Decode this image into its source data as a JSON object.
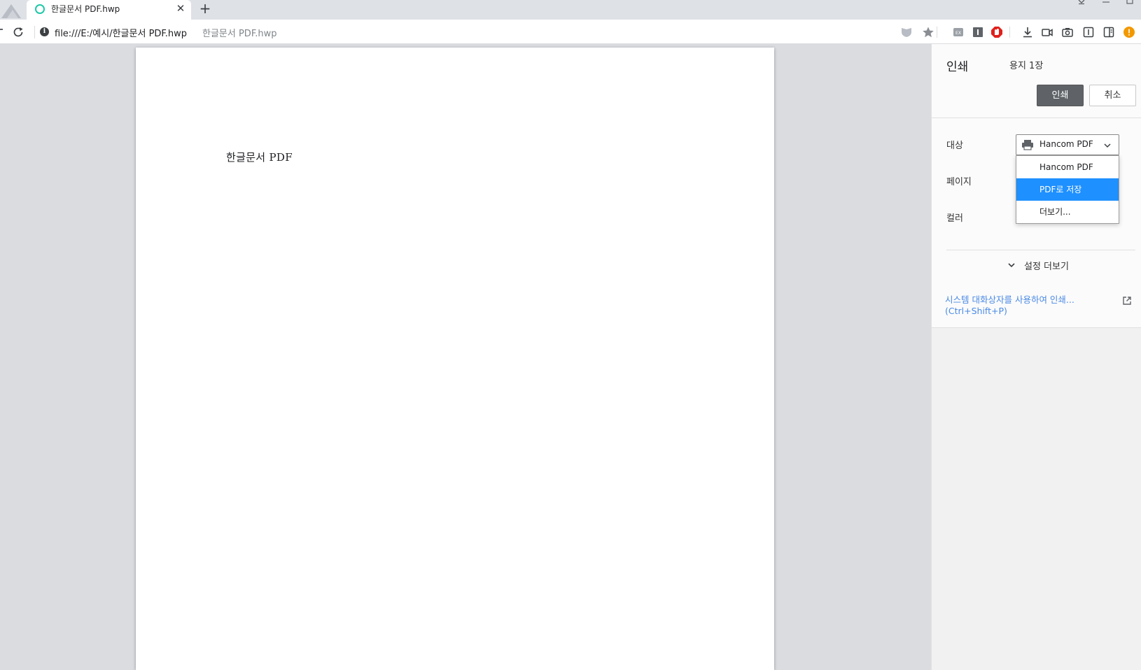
{
  "browser": {
    "tab_title": "한글문서 PDF.hwp",
    "tab_close": "✕",
    "new_tab": "+",
    "url": "file:///E:/예시/한글문서 PDF.hwp",
    "url_page_title": "한글문서 PDF.hwp"
  },
  "document": {
    "page_text": "한글문서 PDF"
  },
  "print": {
    "title": "인쇄",
    "summary": "용지 1장",
    "print_button": "인쇄",
    "cancel_button": "취소",
    "destination_label": "대상",
    "destination_value": "Hancom PDF",
    "pages_label": "페이지",
    "color_label": "컬러",
    "destination_options": [
      "Hancom PDF",
      "PDF로 저장",
      "더보기..."
    ],
    "selected_option_index": 1,
    "more_settings": "설정 더보기",
    "system_dialog_line1": "시스템 대화상자를 사용하여 인쇄...",
    "system_dialog_line2": "(Ctrl+Shift+P)"
  },
  "colors": {
    "accent": "#1e90ff",
    "link": "#4a8ae6",
    "print_button_bg": "#5f6368"
  }
}
